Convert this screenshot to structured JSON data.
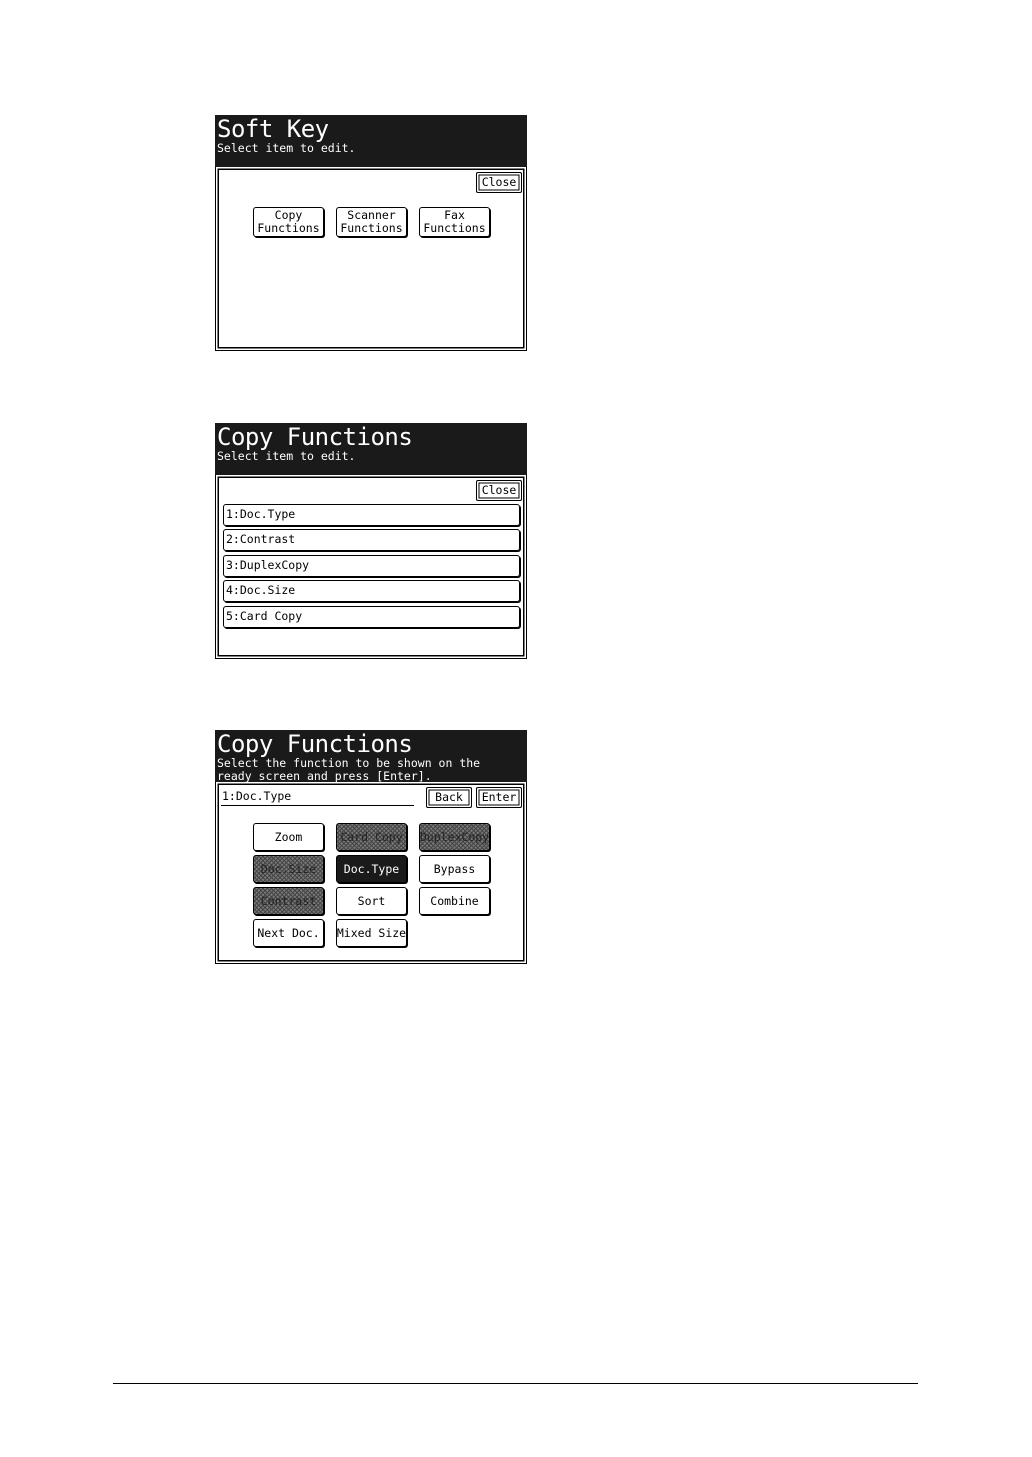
{
  "soft_key_screen": {
    "title": "Soft Key",
    "subtitle": "Select item to edit.",
    "close_label": "Close",
    "buttons": [
      {
        "line1": "Copy",
        "line2": "Functions"
      },
      {
        "line1": "Scanner",
        "line2": "Functions"
      },
      {
        "line1": "Fax",
        "line2": "Functions"
      }
    ]
  },
  "copy_functions_list_screen": {
    "title": "Copy Functions",
    "subtitle": "Select item to edit.",
    "close_label": "Close",
    "items": [
      "1:Doc.Type",
      "2:Contrast",
      "3:DuplexCopy",
      "4:Doc.Size",
      "5:Card Copy"
    ]
  },
  "copy_functions_select_screen": {
    "title": "Copy Functions",
    "subtitle_line1": "Select the function to be shown on the",
    "subtitle_line2": "ready screen and press [Enter].",
    "field_value": "1:Doc.Type",
    "back_label": "Back",
    "enter_label": "Enter",
    "grid": [
      {
        "label": "Zoom",
        "state": "normal"
      },
      {
        "label": "Card Copy",
        "state": "unavailable"
      },
      {
        "label": "DuplexCopy",
        "state": "unavailable"
      },
      {
        "label": "Doc.Size",
        "state": "unavailable"
      },
      {
        "label": "Doc.Type",
        "state": "selected"
      },
      {
        "label": "Bypass",
        "state": "normal"
      },
      {
        "label": "Contrast",
        "state": "unavailable"
      },
      {
        "label": "Sort",
        "state": "normal"
      },
      {
        "label": "Combine",
        "state": "normal"
      },
      {
        "label": "Next Doc.",
        "state": "normal"
      },
      {
        "label": "Mixed Size",
        "state": "normal"
      }
    ]
  }
}
